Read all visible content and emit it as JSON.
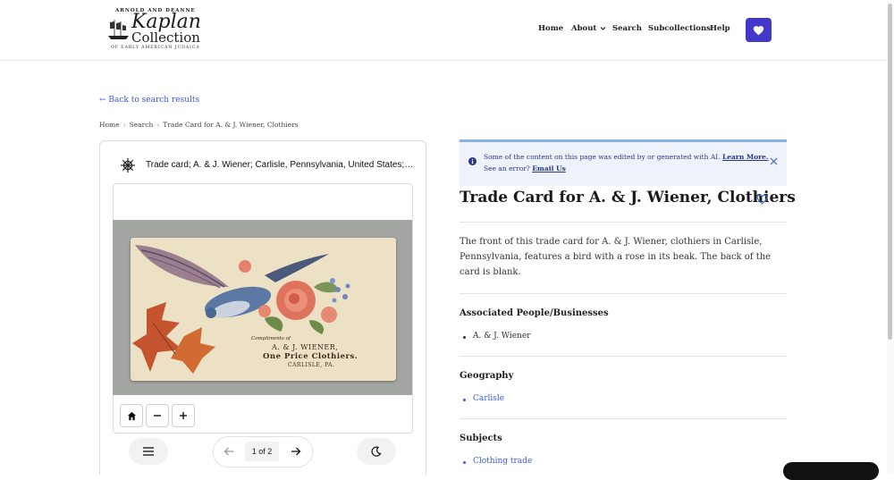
{
  "logo": {
    "line1": "ARNOLD AND DEANNE",
    "line2": "Kaplan",
    "line3": "Collection",
    "line4": "OF EARLY AMERICAN JUDAICA"
  },
  "nav": {
    "home": "Home",
    "about": "About",
    "search": "Search",
    "subcollections": "Subcollections",
    "help": "Help"
  },
  "back_link": "← Back to search results",
  "breadcrumb": [
    "Home",
    "Search",
    "Trade Card for A. & J. Wiener, Clothiers"
  ],
  "breadcrumb_sep": "›",
  "viewer": {
    "title": "Trade card; A. & J. Wiener; Carlisle, Pennsylvania, United States; undated",
    "card_text": {
      "compliments": "Compliments of",
      "name": "A. & J. WIENER,",
      "tagline": "One Price Clothiers.",
      "city": "CARLISLE, PA."
    },
    "pager_label": "1 of 2"
  },
  "notice": {
    "line1": "Some of the content on this page was edited by or generated with AI.",
    "learn_more": "Learn More.",
    "line2": "See an error?",
    "email": "Email Us"
  },
  "item": {
    "title": "Trade Card for A. & J. Wiener, Clothiers",
    "description": "The front of this trade card for A. & J. Wiener, clothiers in Carlisle, Pennsylvania, features a bird with a rose in its beak. The back of the card is blank.",
    "sections": {
      "people_heading": "Associated People/Businesses",
      "people": [
        "A. & J. Wiener"
      ],
      "geo_heading": "Geography",
      "geo": [
        "Carlisle"
      ],
      "subjects_heading": "Subjects",
      "subjects": [
        "Clothing trade"
      ]
    }
  },
  "colors": {
    "accent": "#4338ca",
    "link": "#3b5bdb",
    "notice_bg": "#eef2fb",
    "notice_border": "#8ab0e6"
  }
}
